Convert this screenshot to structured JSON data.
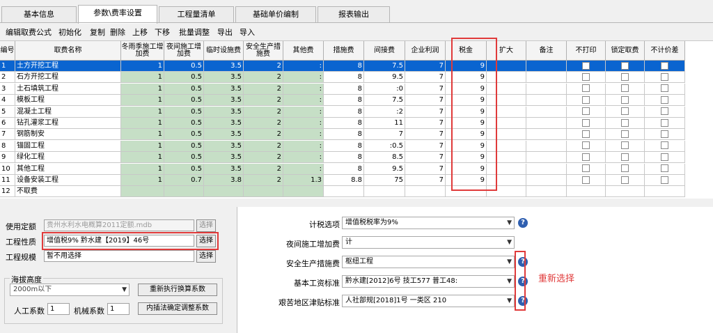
{
  "tabs": [
    "基本信息",
    "参数\\费率设置",
    "工程量清单",
    "基础单价编制",
    "报表输出"
  ],
  "toolbar": [
    "编辑取费公式",
    "初始化",
    "复制",
    "删除",
    "上移",
    "下移",
    "批量调整",
    "导出",
    "导入"
  ],
  "grid": {
    "headers": [
      "编号",
      "取费名称",
      "冬雨季施工增加费",
      "夜间施工增加费",
      "临时设施费",
      "安全生产措施费",
      "其他费",
      "措施费",
      "间接费",
      "企业利润",
      "税金",
      "扩大",
      "备注",
      "不打印",
      "锁定取费",
      "不计价差"
    ],
    "rows": [
      {
        "no": "1",
        "name": "土方开挖工程",
        "winter": "1",
        "night": "0.5",
        "temp": "3.5",
        "safety": "2",
        "other": ":",
        "measure": "8",
        "indirect": "7.5",
        "profit": "7",
        "tax": "9"
      },
      {
        "no": "2",
        "name": "石方开挖工程",
        "winter": "1",
        "night": "0.5",
        "temp": "3.5",
        "safety": "2",
        "other": ":",
        "measure": "8",
        "indirect": "9.5",
        "profit": "7",
        "tax": "9"
      },
      {
        "no": "3",
        "name": "土石填筑工程",
        "winter": "1",
        "night": "0.5",
        "temp": "3.5",
        "safety": "2",
        "other": ":",
        "measure": "8",
        "indirect": ":0",
        "profit": "7",
        "tax": "9"
      },
      {
        "no": "4",
        "name": "模板工程",
        "winter": "1",
        "night": "0.5",
        "temp": "3.5",
        "safety": "2",
        "other": ":",
        "measure": "8",
        "indirect": "7.5",
        "profit": "7",
        "tax": "9"
      },
      {
        "no": "5",
        "name": "混凝土工程",
        "winter": "1",
        "night": "0.5",
        "temp": "3.5",
        "safety": "2",
        "other": ":",
        "measure": "8",
        "indirect": ":2",
        "profit": "7",
        "tax": "9"
      },
      {
        "no": "6",
        "name": "钻孔灌浆工程",
        "winter": "1",
        "night": "0.5",
        "temp": "3.5",
        "safety": "2",
        "other": ":",
        "measure": "8",
        "indirect": "11",
        "profit": "7",
        "tax": "9"
      },
      {
        "no": "7",
        "name": "钢筋制安",
        "winter": "1",
        "night": "0.5",
        "temp": "3.5",
        "safety": "2",
        "other": ":",
        "measure": "8",
        "indirect": "7",
        "profit": "7",
        "tax": "9"
      },
      {
        "no": "8",
        "name": "锚固工程",
        "winter": "1",
        "night": "0.5",
        "temp": "3.5",
        "safety": "2",
        "other": ":",
        "measure": "8",
        "indirect": ":0.5",
        "profit": "7",
        "tax": "9"
      },
      {
        "no": "9",
        "name": "绿化工程",
        "winter": "1",
        "night": "0.5",
        "temp": "3.5",
        "safety": "2",
        "other": ":",
        "measure": "8",
        "indirect": "8.5",
        "profit": "7",
        "tax": "9"
      },
      {
        "no": "10",
        "name": "其他工程",
        "winter": "1",
        "night": "0.5",
        "temp": "3.5",
        "safety": "2",
        "other": ":",
        "measure": "8",
        "indirect": "9.5",
        "profit": "7",
        "tax": "9"
      },
      {
        "no": "11",
        "name": "设备安装工程",
        "winter": "1",
        "night": "0.7",
        "temp": "3.8",
        "safety": "2",
        "other": "1.3",
        "measure": "8.8",
        "indirect": "75",
        "profit": "7",
        "tax": "9"
      },
      {
        "no": "12",
        "name": "不取费",
        "winter": "",
        "night": "",
        "temp": "",
        "safety": "",
        "other": "",
        "measure": "",
        "indirect": "",
        "profit": "",
        "tax": ""
      }
    ]
  },
  "left_panel": {
    "quota_label": "使用定额",
    "quota_value": "贵州水利水电概算2011定额.mdb",
    "quota_btn": "选择",
    "nature_label": "工程性质",
    "nature_value": "增值税9% 黔水建【2019】46号",
    "nature_btn": "选择",
    "scale_label": "工程规模",
    "scale_value": "暂不用选择",
    "scale_btn": "选择",
    "altitude_title": "海拔高度",
    "altitude_value": "2000m以下",
    "recalc_btn": "重新执行换算系数",
    "labor_label": "人工系数",
    "labor_value": "1",
    "machine_label": "机械系数",
    "machine_value": "1",
    "interp_btn": "内插法确定调整系数"
  },
  "right_panel": {
    "rows": [
      {
        "label": "计税选项",
        "value": "增值税税率为9%"
      },
      {
        "label": "夜间施工增加费",
        "value": "计"
      },
      {
        "label": "安全生产措施费",
        "value": "枢纽工程"
      },
      {
        "label": "基本工资标准",
        "value": "黔水建[2012]6号 技工577 普工48:"
      },
      {
        "label": "艰苦地区津贴标准",
        "value": "人社部规[2018]1号 一类区 210"
      }
    ],
    "annotation": "重新选择"
  },
  "colors": {
    "highlight": "#e03a3a",
    "selected": "#0a64d0",
    "green": "#c6dfc6"
  }
}
